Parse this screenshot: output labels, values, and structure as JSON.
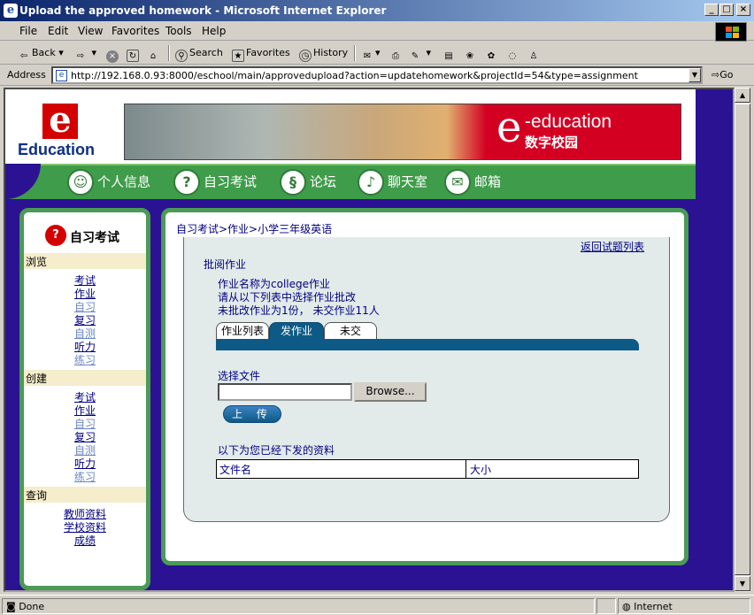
{
  "window": {
    "title": "Upload the approved homework - Microsoft Internet Explorer",
    "icon": "ie-icon"
  },
  "menu": [
    "File",
    "Edit",
    "View",
    "Favorites",
    "Tools",
    "Help"
  ],
  "toolbar": {
    "back": "Back",
    "search": "Search",
    "favorites": "Favorites",
    "history": "History"
  },
  "address": {
    "label": "Address",
    "url": "http://192.168.0.93:8000/eschool/main/approvedupload?action=updatehomework&projectId=54&type=assignment",
    "go": "Go"
  },
  "site": {
    "logo_letter": "e",
    "logo_text": "Education",
    "banner_e": "e",
    "banner_brand": "-education",
    "banner_cn": "数字校园",
    "nav": [
      "个人信息",
      "自习考试",
      "论坛",
      "聊天室",
      "邮箱"
    ]
  },
  "sidebar": {
    "title": "自习考试",
    "sections": [
      {
        "label": "浏览",
        "links": [
          "考试",
          "作业",
          "自习",
          "复习",
          "自测",
          "听力",
          "练习"
        ]
      },
      {
        "label": "创建",
        "links": [
          "考试",
          "作业",
          "自习",
          "复习",
          "自测",
          "听力",
          "练习"
        ]
      },
      {
        "label": "查询",
        "links": [
          "教师资料",
          "学校资料",
          "成绩"
        ]
      }
    ]
  },
  "main": {
    "breadcrumb": "自习考试>作业>小学三年级英语",
    "back_link": "返回试题列表",
    "section_title": "批阅作业",
    "info1": "作业名称为college作业",
    "info2": "请从以下列表中选择作业批改",
    "info3": "未批改作业为1份，  未交作业11人",
    "tabs": [
      "作业列表",
      "发作业",
      "未交"
    ],
    "choose_file": "选择文件",
    "browse": "Browse...",
    "upload": "上 传",
    "sent_title": "以下为您已经下发的资料",
    "table_headers": [
      "文件名",
      "大小"
    ]
  },
  "status": {
    "left": "Done",
    "zone": "Internet"
  },
  "colors": {
    "page_bg": "#2b1292",
    "green": "#4a9b55",
    "brand_red": "#d40000",
    "link_blue": "#000080",
    "tab_blue": "#0d5a86"
  }
}
